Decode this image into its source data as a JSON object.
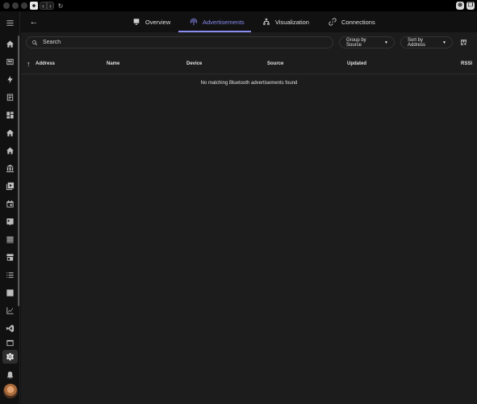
{
  "tabs": [
    {
      "label": "Overview",
      "icon": "monitor-icon"
    },
    {
      "label": "Advertisements",
      "icon": "broadcast-icon"
    },
    {
      "label": "Visualization",
      "icon": "network-icon"
    },
    {
      "label": "Connections",
      "icon": "link-icon"
    }
  ],
  "active_tab": "Advertisements",
  "search": {
    "placeholder": "Search",
    "value": ""
  },
  "group_by": {
    "label": "Group by Source"
  },
  "sort_by": {
    "label": "Sort by Address"
  },
  "table": {
    "columns": [
      "Address",
      "Name",
      "Device",
      "Source",
      "Updated",
      "RSSI"
    ],
    "sort_column": "Address",
    "empty_message": "No matching Bluetooth advertisements found"
  },
  "sidebar": {
    "items": [
      "menu-icon",
      "home-icon",
      "news-icon",
      "energy-icon",
      "logbook-icon",
      "dashboard-icon",
      "home-icon",
      "home-icon",
      "library-icon",
      "media-icon",
      "calendar-icon",
      "badge-icon",
      "list-icon",
      "store-icon",
      "checklist-icon",
      "image-icon",
      "chart-icon",
      "code-icon",
      "terminal-icon",
      "settings-icon",
      "bell-icon"
    ],
    "active": "settings-icon"
  },
  "colors": {
    "accent": "#8a8cf2",
    "panel": "#1c1c1c",
    "background": "#111111"
  }
}
